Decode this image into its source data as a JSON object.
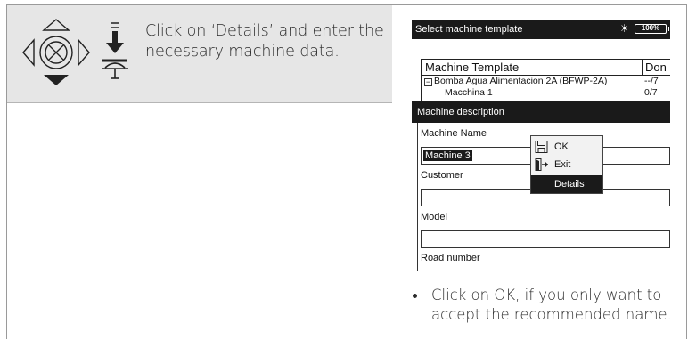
{
  "instruction": {
    "text": "Click on ‘Details’ and enter the necessary machine data.",
    "nav_icon": "navigation-pad-icon",
    "enter_icon": "enter-key-icon"
  },
  "device": {
    "title": "Select machine template",
    "battery": "100%",
    "signal_icon": "signal-icon",
    "tree": {
      "headers": [
        "Machine Template",
        "Don"
      ],
      "rows": [
        {
          "name": "Bomba Agua Alimentacion 2A (BFWP-2A)",
          "value": "--/7",
          "expander": "−"
        },
        {
          "name": "Macchina 1",
          "value": "0/7"
        }
      ]
    },
    "dialog": {
      "title": "Machine description",
      "fields": [
        {
          "label": "Machine Name",
          "value": "Machine 3"
        },
        {
          "label": "Customer",
          "value": ""
        },
        {
          "label": "Model",
          "value": ""
        },
        {
          "label": "Road number",
          "value": ""
        }
      ]
    },
    "popup": {
      "items": [
        {
          "label": "OK",
          "icon": "save-icon"
        },
        {
          "label": "Exit",
          "icon": "exit-icon"
        },
        {
          "label": "Details",
          "icon": ""
        }
      ],
      "active_index": 2
    }
  },
  "note": {
    "text": "Click on OK, if you only want to accept the recommended name."
  }
}
